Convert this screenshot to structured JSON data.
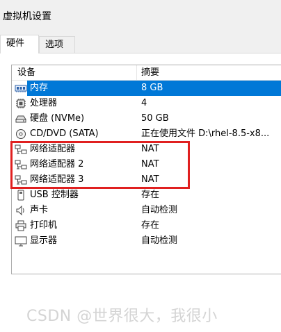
{
  "window": {
    "title": "虚拟机设置"
  },
  "tabs": [
    {
      "label": "硬件",
      "active": true
    },
    {
      "label": "选项",
      "active": false
    }
  ],
  "table": {
    "columns": [
      "设备",
      "摘要"
    ],
    "rows": [
      {
        "icon": "memory-icon",
        "device": "内存",
        "summary": "8 GB",
        "selected": true
      },
      {
        "icon": "processor-icon",
        "device": "处理器",
        "summary": "4",
        "selected": false
      },
      {
        "icon": "hard-disk-icon",
        "device": "硬盘 (NVMe)",
        "summary": "50 GB",
        "selected": false
      },
      {
        "icon": "cd-dvd-icon",
        "device": "CD/DVD (SATA)",
        "summary": "正在使用文件 D:\\rhel-8.5-x8...",
        "selected": false
      },
      {
        "icon": "network-adapter-icon",
        "device": "网络适配器",
        "summary": "NAT",
        "selected": false
      },
      {
        "icon": "network-adapter-icon",
        "device": "网络适配器 2",
        "summary": "NAT",
        "selected": false
      },
      {
        "icon": "network-adapter-icon",
        "device": "网络适配器 3",
        "summary": "NAT",
        "selected": false
      },
      {
        "icon": "usb-controller-icon",
        "device": "USB 控制器",
        "summary": "存在",
        "selected": false
      },
      {
        "icon": "sound-card-icon",
        "device": "声卡",
        "summary": "自动检测",
        "selected": false
      },
      {
        "icon": "printer-icon",
        "device": "打印机",
        "summary": "存在",
        "selected": false
      },
      {
        "icon": "display-icon",
        "device": "显示器",
        "summary": "自动检测",
        "selected": false
      }
    ]
  },
  "annotation": {
    "color": "#e02020"
  },
  "watermark": {
    "text": "CSDN @世界很大，我很小"
  },
  "colors": {
    "selection": "#0078d7"
  }
}
